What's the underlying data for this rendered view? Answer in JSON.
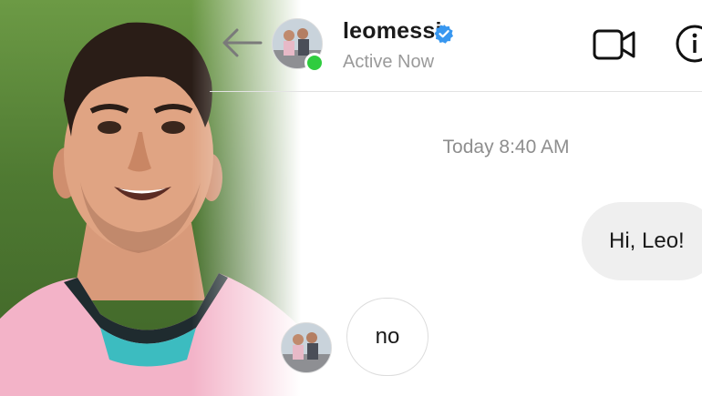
{
  "header": {
    "username": "leomessi",
    "status": "Active Now",
    "icons": {
      "back": "back-arrow-icon",
      "verified": "verified-badge-icon",
      "video": "video-call-icon",
      "info": "info-icon"
    }
  },
  "conversation": {
    "timestamp": "Today 8:40 AM",
    "messages": [
      {
        "from": "me",
        "text": "Hi, Leo!"
      },
      {
        "from": "leomessi",
        "text": "no"
      }
    ]
  },
  "colors": {
    "verified_blue": "#3897f0",
    "online_green": "#2fcc3f",
    "bubble_gray": "#efefef",
    "muted_text": "#9a9a9a"
  }
}
